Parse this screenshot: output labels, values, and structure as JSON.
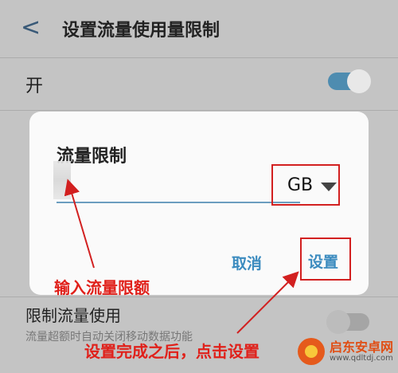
{
  "header": {
    "back_glyph": "<",
    "title": "设置流量使用量限制"
  },
  "settings": {
    "on_label": "开",
    "limit_usage_label": "限制流量使用",
    "limit_usage_desc": "流量超额时自动关闭移动数据功能"
  },
  "dialog": {
    "title": "流量限制",
    "unit": "GB",
    "cancel": "取消",
    "confirm": "设置"
  },
  "annotations": {
    "enter_limit": "输入流量限额",
    "after_setting": "设置完成之后，点击设置"
  },
  "watermark": {
    "name": "启东安卓网",
    "url": "www.qdltdj.com"
  },
  "colors": {
    "accent": "#3b8bbf",
    "annotation": "#d22020",
    "toggle_on": "#4e8cb0"
  }
}
